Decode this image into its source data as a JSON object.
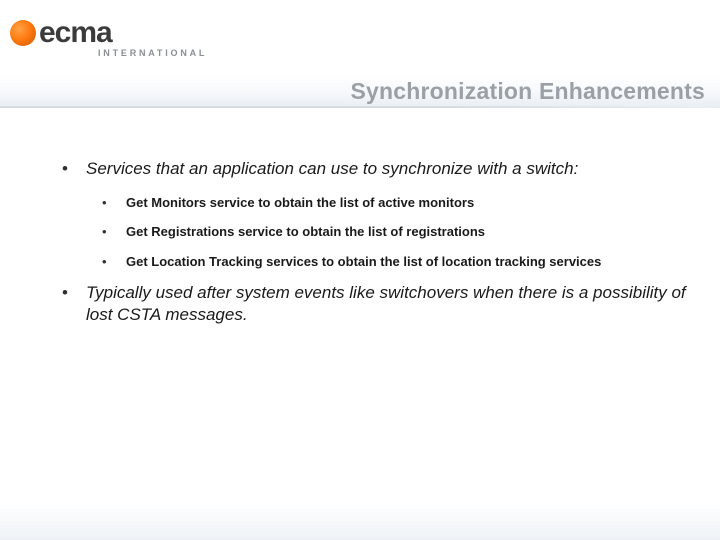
{
  "logo": {
    "word": "ecma",
    "subtitle": "INTERNATIONAL"
  },
  "title": "Synchronization Enhancements",
  "bullets": [
    {
      "text": "Services that an application can use to synchronize with a switch:",
      "children": [
        "Get Monitors service to obtain the list of active monitors",
        "Get Registrations service to obtain the list of registrations",
        "Get Location Tracking services to obtain the list of location tracking services"
      ]
    },
    {
      "text": "Typically used after system events like switchovers when there is a possibility of lost CSTA messages.",
      "children": []
    }
  ]
}
